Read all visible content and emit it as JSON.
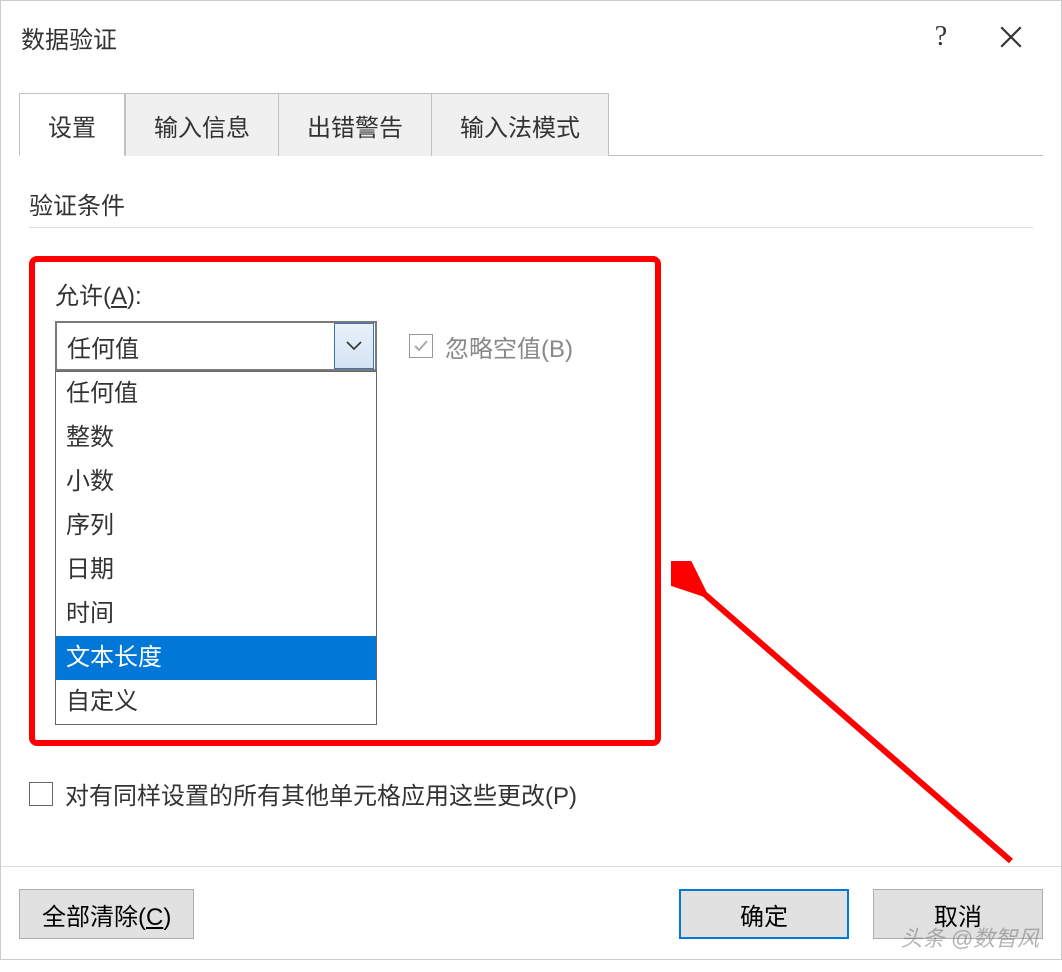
{
  "title": "数据验证",
  "tabs": [
    "设置",
    "输入信息",
    "出错警告",
    "输入法模式"
  ],
  "section": "验证条件",
  "allow_label_pre": "允许(",
  "allow_label_u": "A",
  "allow_label_post": "):",
  "combo_value": "任何值",
  "ignore_blank": "忽略空值(B)",
  "dropdown_items": [
    "任何值",
    "整数",
    "小数",
    "序列",
    "日期",
    "时间",
    "文本长度",
    "自定义"
  ],
  "dropdown_selected_index": 6,
  "apply_all": "对有同样设置的所有其他单元格应用这些更改(P)",
  "clear_all": "全部清除(C)",
  "clear_all_u": "C",
  "ok": "确定",
  "cancel": "取消",
  "watermark": "头条 @数智风"
}
